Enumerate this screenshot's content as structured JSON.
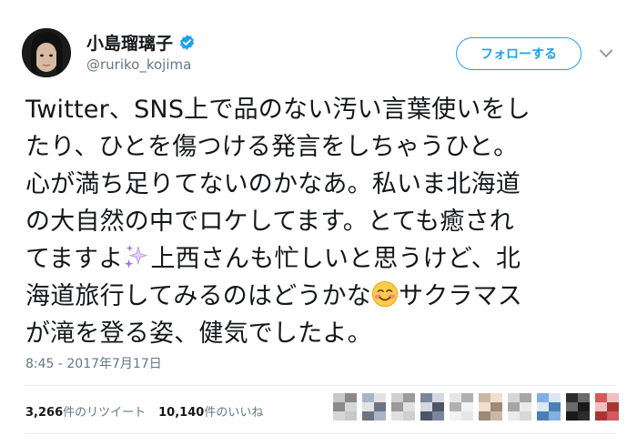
{
  "user": {
    "display_name": "小島瑠璃子",
    "handle": "@ruriko_kojima",
    "verified": true
  },
  "follow_button": {
    "label": "フォローする"
  },
  "tweet": {
    "lines": [
      "Twitter、SNS上で品のない汚い言葉使いをし",
      "たり、ひとを傷つける発言をしちゃうひと。",
      "心が満ち足りてないのかなあ。私いま北海道",
      "の大自然の中でロケしてます。とても癒され",
      {
        "before": "てますよ",
        "emoji": "sparkles-emoji",
        "after": "上西さんも忙しいと思うけど、北"
      },
      {
        "before": "海道旅行してみるのはどうかな",
        "emoji": "blushing-face-emoji",
        "after": "サクラマス"
      },
      "が滝を登る姿、健気でしたよ。"
    ]
  },
  "timestamp": "8:45 - 2017年7月17日",
  "stats": {
    "retweets_count": "3,266",
    "retweets_label": "件のリツイート",
    "likes_count": "10,140",
    "likes_label": "件のいいね"
  },
  "colors": {
    "accent": "#1da1f2",
    "text": "#14171a",
    "muted": "#657786"
  },
  "liker_avatars": [
    {
      "colors": [
        "#c8c8c8",
        "#8a8a8a",
        "#d6d6d6"
      ]
    },
    {
      "colors": [
        "#a9b4c6",
        "#e3e3e3",
        "#6d7380"
      ]
    },
    {
      "colors": [
        "#cfcfcf",
        "#9a9a9a",
        "#e0e0e0"
      ]
    },
    {
      "colors": [
        "#7a86a0",
        "#d5d8e0",
        "#4d5566"
      ]
    },
    {
      "colors": [
        "#e6e6e6",
        "#b0b0b0",
        "#f2f2f2"
      ]
    },
    {
      "colors": [
        "#cbb8a4",
        "#eedfce",
        "#a08a74"
      ]
    },
    {
      "colors": [
        "#d7d7d7",
        "#a6a6a6",
        "#eaeaea"
      ]
    },
    {
      "colors": [
        "#7fb0e0",
        "#d8e8f6",
        "#4a7fb8"
      ]
    },
    {
      "colors": [
        "#2c2c2c",
        "#6a6a6a",
        "#1a1a1a"
      ]
    },
    {
      "colors": [
        "#d45a5a",
        "#f0c0c0",
        "#a83434"
      ]
    }
  ]
}
